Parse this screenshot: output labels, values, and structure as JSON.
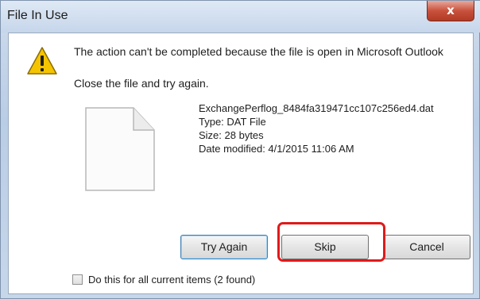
{
  "window": {
    "title": "File In Use",
    "close_glyph": "x"
  },
  "dialog": {
    "message": "The action can't be completed because the file is open in Microsoft Outlook",
    "instruction": "Close the file and try again."
  },
  "file": {
    "name": "ExchangePerflog_8484fa319471cc107c256ed4.dat",
    "type": "Type: DAT File",
    "size": "Size: 28 bytes",
    "date_modified": "Date modified: 4/1/2015 11:06 AM"
  },
  "buttons": {
    "try_again": "Try Again",
    "skip": "Skip",
    "cancel": "Cancel"
  },
  "checkbox": {
    "label": "Do this for all current items (2 found)",
    "checked": false
  },
  "colors": {
    "highlight": "#e01a1a",
    "warning_yellow": "#f5c400",
    "close_red": "#c8523d"
  },
  "icons": {
    "warning": "warning-icon",
    "file": "file-icon"
  }
}
